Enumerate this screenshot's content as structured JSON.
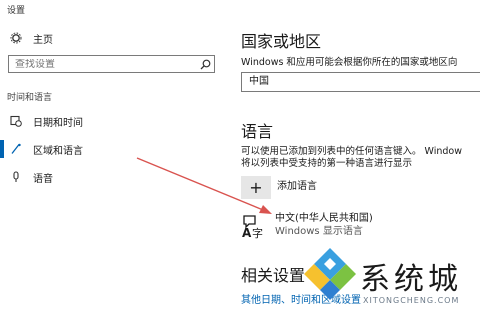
{
  "window": {
    "title": "设置"
  },
  "sidebar": {
    "home_label": "主页",
    "search_placeholder": "查找设置",
    "section_title": "时间和语言",
    "items": [
      {
        "label": "日期和时间",
        "icon": "calendar-clock-icon"
      },
      {
        "label": "区域和语言",
        "icon": "region-language-icon",
        "active": true
      },
      {
        "label": "语音",
        "icon": "microphone-icon"
      }
    ]
  },
  "main": {
    "country": {
      "heading": "国家或地区",
      "description": "Windows 和应用可能会根据你所在的国家或地区向",
      "value": "中国"
    },
    "language": {
      "heading": "语言",
      "description_line1": "可以使用已添加到列表中的任何语言键入。 Window",
      "description_line2": "将以列表中受支持的第一种语言进行显示",
      "add_label": "添加语言",
      "items": [
        {
          "name": "中文(中华人民共和国)",
          "sub": "Windows 显示语言"
        }
      ]
    },
    "related": {
      "heading": "相关设置",
      "link": "其他日期、时间和区域设置"
    }
  },
  "watermark": {
    "text": "系统城",
    "url": "XITONGCHENG.COM"
  },
  "colors": {
    "accent": "#0063b1",
    "arrow": "#d9534f"
  }
}
